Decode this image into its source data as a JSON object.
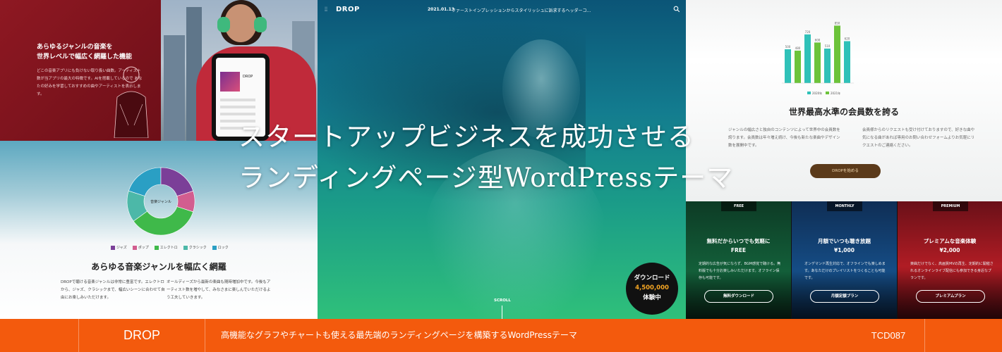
{
  "hero": {
    "logo": "DROP",
    "news_date": "2021.01.13",
    "news_text": "ファーストインプレッションからスタイリッシュに訴求するヘッダーコ...",
    "scroll_label": "SCROLL",
    "badge": {
      "line1": "ダウンロード",
      "line2": "4,500,000",
      "line3": "体験中"
    }
  },
  "headline": {
    "line1": "スタートアップビジネスを成功させる",
    "line2": "ランディングページ型WordPressテーマ"
  },
  "left_top": {
    "heading_line1": "あらゆるジャンルの音楽を",
    "heading_line2": "世界レベルで幅広く網羅した機能",
    "body": "どこの音楽アプリにも負けない取り扱い曲数。アーティスト数が当アプリの最大の特徴です。AIを搭載しているので あなたの好みを学習しておすすめの曲やアーティストを表示します。",
    "phone_title": "DROP"
  },
  "donut_panel": {
    "center_label": "音楽ジャンル",
    "legend": [
      "ジャズ",
      "ポップ",
      "エレクトロ",
      "クラシック",
      "ロック"
    ],
    "title": "あらゆる音楽ジャンルを幅広く網羅",
    "body_left": "DROPで聴ける音楽ジャンルは非常に豊富です。エレクトロから、ジャズ、クラシックまで、幅広いシーンに合わせて自由にお楽しみいただけます。",
    "body_right": "オールディーズから最新の楽曲も随時増加中です。今後もアーティスト数を増やして、みなさまに楽しんでいただけるよう工夫していきます。"
  },
  "bars_panel": {
    "title": "世界最高水準の会員数を誇る",
    "body_left": "ジャンルの幅広さと独自のコンテンツによって世界中の会員数を誇ります。会員数は年々増え続け、今後も新たな楽曲やデザイン数を展開中です。",
    "body_right": "会員様からのリクエストも受け付けておりますので、好きな曲や気になる曲があれば専用のお問い合わせフォームよりお気軽にリクエストのご連絡ください。",
    "button": "DROPを始める",
    "legend": [
      "2020年",
      "2021年"
    ]
  },
  "plans": [
    {
      "tab": "FREE",
      "title_line1": "無料だからいつでも気軽に",
      "title_line2": "FREE",
      "body": "定期的な広告が気にならず、BGM感覚で聴ける。無料版でも十分お楽しみいただけます。オフライン保存も可能です。",
      "button": "無料ダウンロード"
    },
    {
      "tab": "MONTHLY",
      "title_line1": "月額でいつも聴き放題",
      "title_line2": "¥1,000",
      "body": "オンデマンド再生対応で、オフラインでも楽しめます。あなただけのプレイリストをつくることも可能です。",
      "button": "月額定額プラン"
    },
    {
      "tab": "PREMIUM",
      "title_line1": "プレミアムな音楽体験",
      "title_line2": "¥2,000",
      "body": "楽曲だけでなく、高画質MVの再生、定期的に開催されるオンラインライブ配信にも参加できる身近なプランです。",
      "button": "プレミアムプラン"
    }
  ],
  "bottom_bar": {
    "brand": "DROP",
    "description": "高機能なグラフやチャートも使える最先端のランディングページを構築するWordPressテーマ",
    "code": "TCD087"
  },
  "colors": {
    "accent_orange": "#f35a0d",
    "donut": [
      "#7b3f98",
      "#d25d8f",
      "#3fb94a",
      "#4cb8a8",
      "#2a9fc4"
    ],
    "bar_2020": "#2fc1b8",
    "bar_2021": "#6cc33a"
  },
  "chart_data": [
    {
      "type": "pie",
      "labels": [
        "ジャズ",
        "ポップ",
        "エレクトロ",
        "クラシック",
        "ロック"
      ],
      "values": [
        20,
        10,
        35,
        15,
        20
      ]
    },
    {
      "type": "bar",
      "series": [
        {
          "name": "2020年",
          "values": [
            500,
            460,
            720,
            400,
            510,
            520,
            620
          ]
        },
        {
          "name": "2021年",
          "values": [
            540,
            480,
            750,
            600,
            580,
            850,
            900
          ]
        }
      ]
    }
  ]
}
